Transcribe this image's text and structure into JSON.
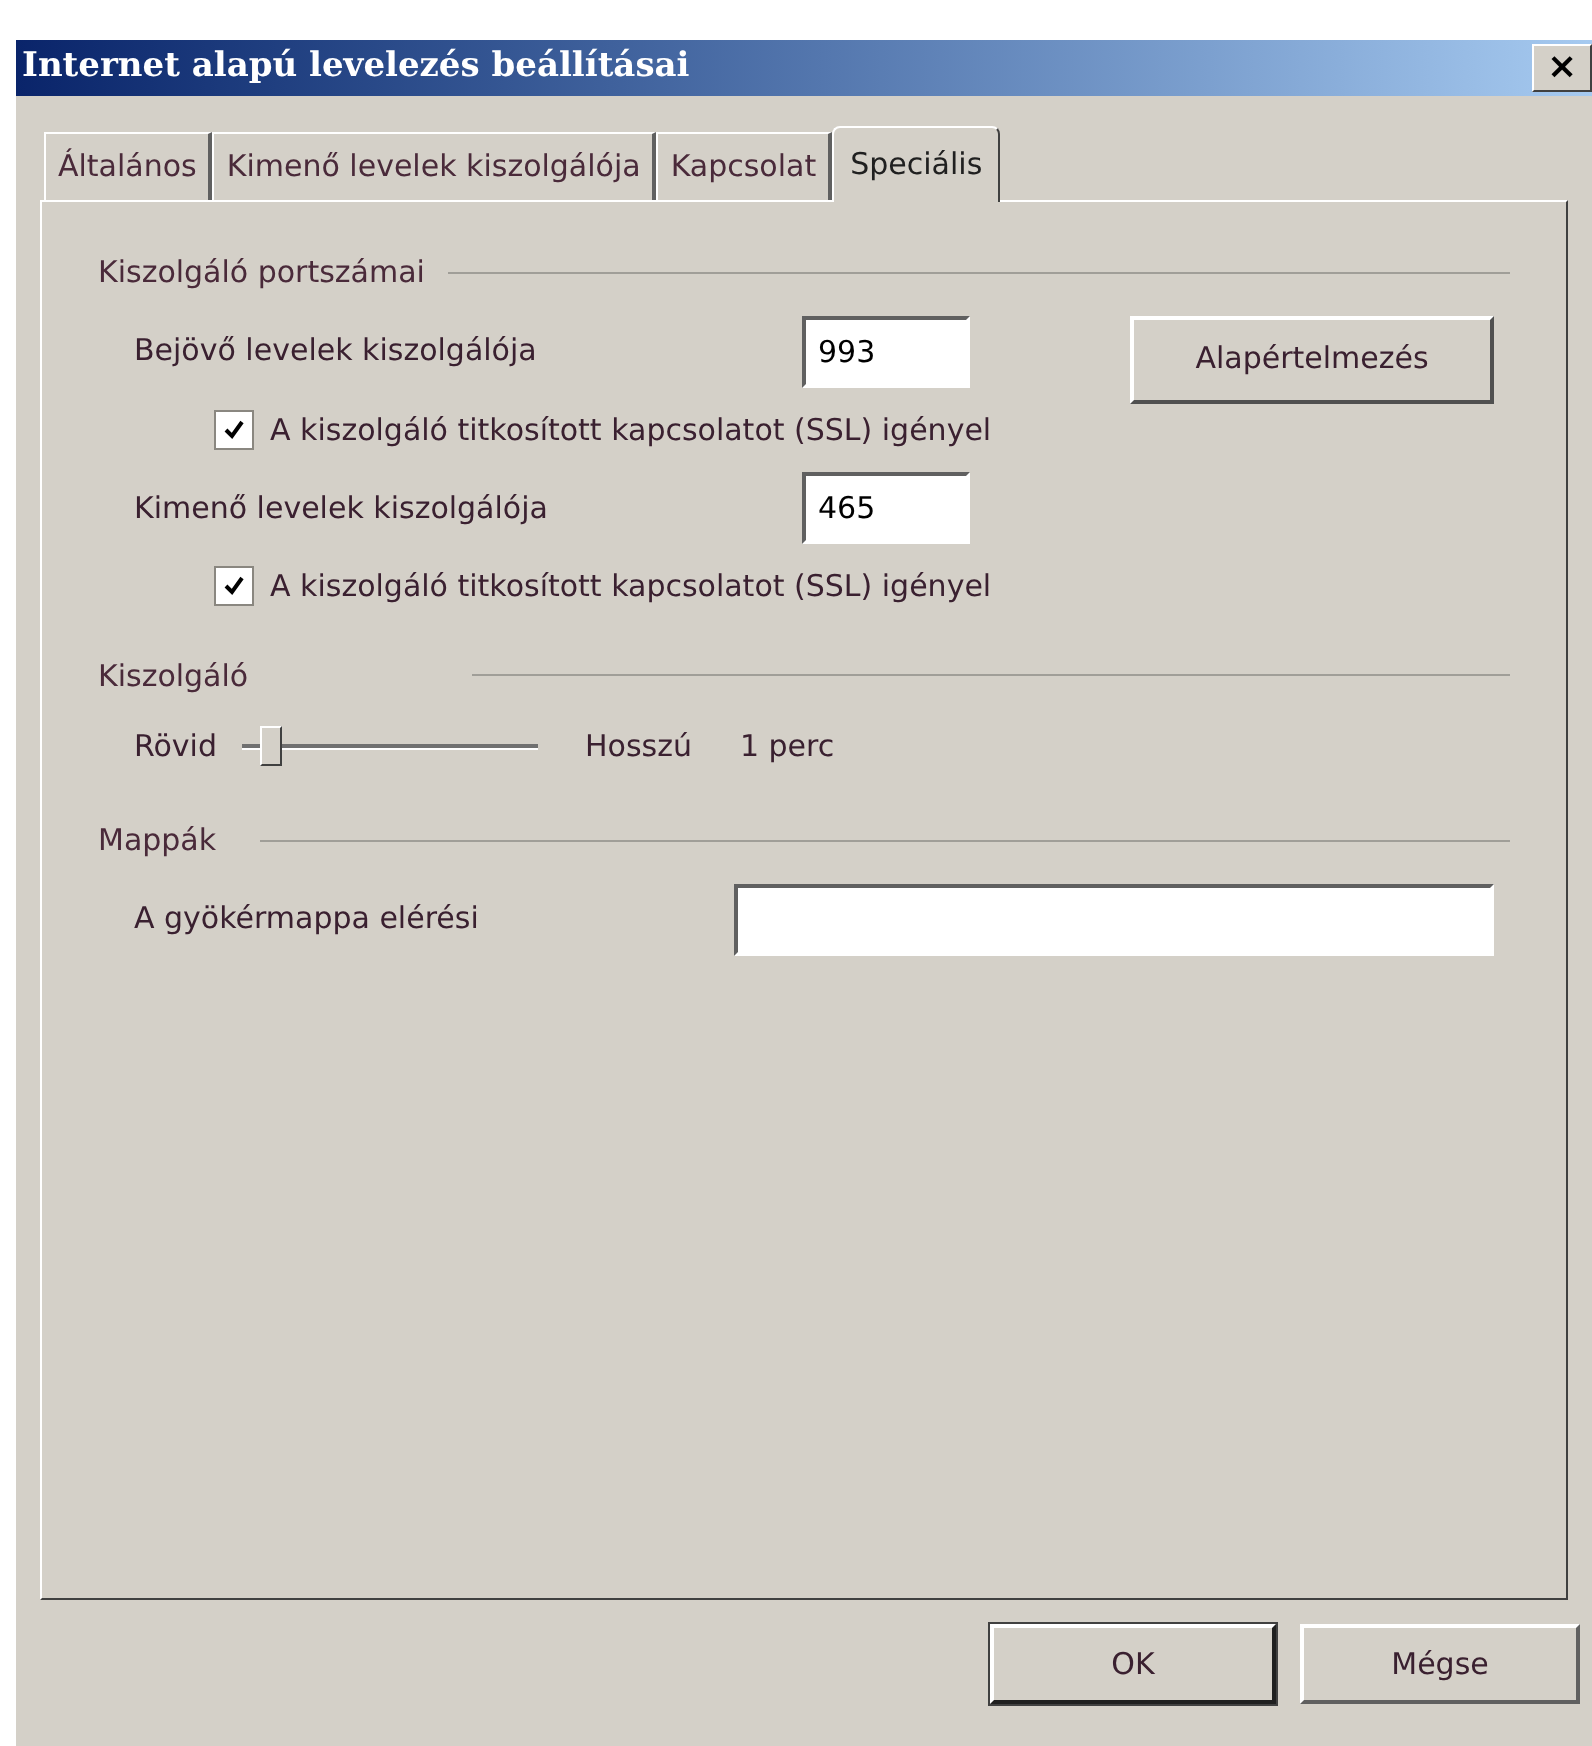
{
  "window": {
    "title": "Internet alapú levelezés beállításai",
    "close": "×"
  },
  "tabs": [
    {
      "label": "Általános",
      "selected": false
    },
    {
      "label": "Kimenő levelek kiszolgálója",
      "selected": false
    },
    {
      "label": "Kapcsolat",
      "selected": false
    },
    {
      "label": "Speciális",
      "selected": true
    }
  ],
  "ports": {
    "title": "Kiszolgáló portszámai",
    "incoming": {
      "label": "Bejövő levelek kiszolgálója",
      "value": "993",
      "ssl": {
        "label": "A kiszolgáló titkosított kapcsolatot (SSL) igényel",
        "checked": true
      }
    },
    "default_button": "Alapértelmezés",
    "outgoing": {
      "label": "Kimenő levelek kiszolgálója",
      "value": "465",
      "ssl": {
        "label": "A kiszolgáló titkosított kapcsolatot (SSL) igényel",
        "checked": true
      }
    }
  },
  "server": {
    "title": "Kiszolgáló",
    "min_label": "Rövid",
    "max_label": "Hosszú",
    "level": 0.1,
    "reading": "1 perc"
  },
  "folders": {
    "title": "Mappák",
    "root_label": "A gyökérmappa elérési"
  },
  "buttons": [
    "OK",
    "Mégse"
  ]
}
